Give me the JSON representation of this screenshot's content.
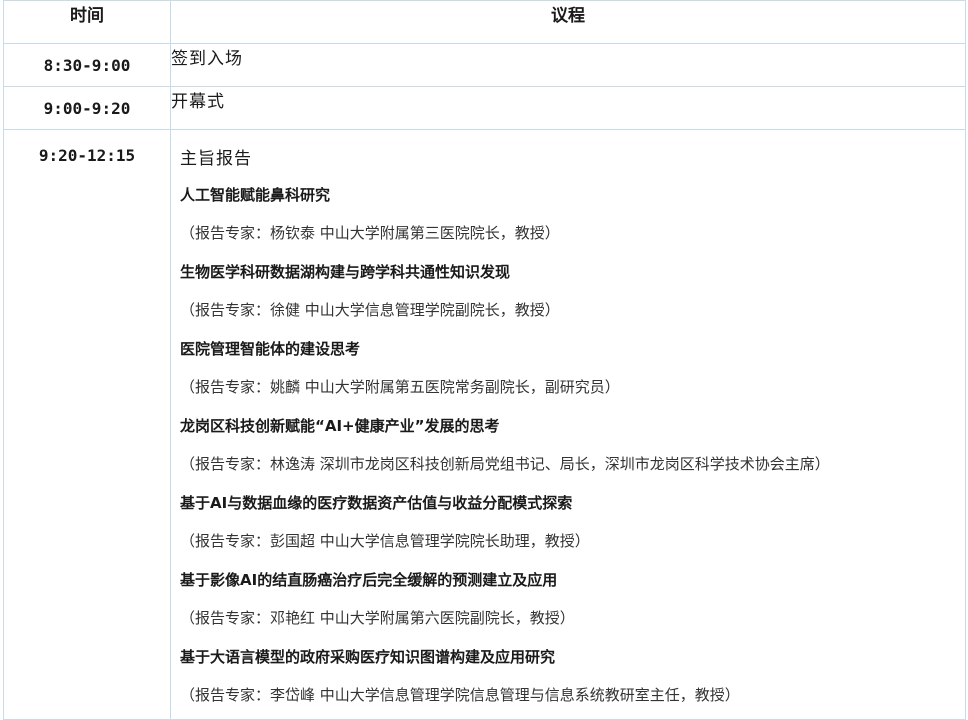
{
  "header": {
    "time_label": "时间",
    "agenda_label": "议程"
  },
  "rows": [
    {
      "time": "8:30-9:00",
      "agenda": "签到入场"
    },
    {
      "time": "9:00-9:20",
      "agenda": "开幕式"
    }
  ],
  "keynote": {
    "time": "9:20-12:15",
    "title": "主旨报告",
    "talks": [
      {
        "title": "人工智能赋能鼻科研究",
        "speaker": "（报告专家：杨钦泰 中山大学附属第三医院院长，教授）"
      },
      {
        "title": "生物医学科研数据湖构建与跨学科共通性知识发现",
        "speaker": "（报告专家：徐健 中山大学信息管理学院副院长，教授）"
      },
      {
        "title": "医院管理智能体的建设思考",
        "speaker": "（报告专家：姚麟 中山大学附属第五医院常务副院长，副研究员）"
      },
      {
        "title": "龙岗区科技创新赋能“AI+健康产业”发展的思考",
        "speaker": "（报告专家：林逸涛 深圳市龙岗区科技创新局党组书记、局长，深圳市龙岗区科学技术协会主席）"
      },
      {
        "title": "基于AI与数据血缘的医疗数据资产估值与收益分配模式探索",
        "speaker": "（报告专家：彭国超 中山大学信息管理学院院长助理，教授）"
      },
      {
        "title": "基于影像AI的结直肠癌治疗后完全缓解的预测建立及应用",
        "speaker": "（报告专家：邓艳红 中山大学附属第六医院副院长，教授）"
      },
      {
        "title": "基于大语言模型的政府采购医疗知识图谱构建及应用研究",
        "speaker": "（报告专家：李岱峰 中山大学信息管理学院信息管理与信息系统教研室主任，教授）"
      }
    ]
  }
}
